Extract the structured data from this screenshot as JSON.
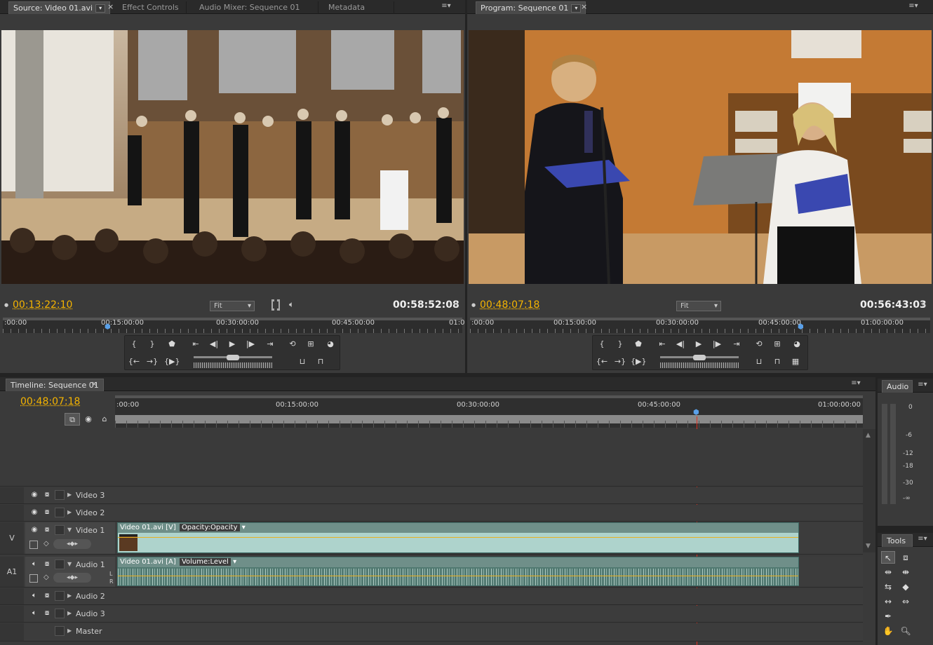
{
  "source": {
    "tabs": [
      "Source: Video 01.avi",
      "Effect Controls",
      "Audio Mixer: Sequence 01",
      "Metadata"
    ],
    "current_timecode": "00:13:22:10",
    "duration_timecode": "00:58:52:08",
    "fit": "Fit",
    "ruler_labels": [
      ":00:00",
      "00:15:00:00",
      "00:30:00:00",
      "00:45:00:00",
      "01:0"
    ]
  },
  "program": {
    "tabs": [
      "Program: Sequence 01"
    ],
    "current_timecode": "00:48:07:18",
    "duration_timecode": "00:56:43:03",
    "fit": "Fit",
    "ruler_labels": [
      ":00:00",
      "00:15:00:00",
      "00:30:00:00",
      "00:45:00:00",
      "01:00:00:00"
    ]
  },
  "timeline": {
    "tab": "Timeline: Sequence 01",
    "current_timecode": "00:48:07:18",
    "ruler_labels": [
      ":00:00",
      "00:15:00:00",
      "00:30:00:00",
      "00:45:00:00",
      "01:00:00:00"
    ],
    "tracks": {
      "video3": "Video 3",
      "video2": "Video 2",
      "video1": "Video 1",
      "audio1": "Audio 1",
      "audio2": "Audio 2",
      "audio3": "Audio 3",
      "master": "Master"
    },
    "side_labels": {
      "v": "V",
      "a1": "A1",
      "l": "L",
      "r": "R"
    },
    "video_clip": {
      "name": "Video 01.avi [V]",
      "effect": "Opacity:Opacity"
    },
    "audio_clip": {
      "name": "Video 01.avi [A]",
      "effect": "Volume:Level"
    }
  },
  "audio_panel": {
    "tab": "Audio",
    "scale": [
      "0",
      "-6",
      "-12",
      "-18",
      "-30",
      "-∞"
    ]
  },
  "tools_panel": {
    "tab": "Tools"
  },
  "colors": {
    "accent_timecode": "#f5b400",
    "playhead": "#e03020",
    "clip_video": "#aed3cc"
  }
}
